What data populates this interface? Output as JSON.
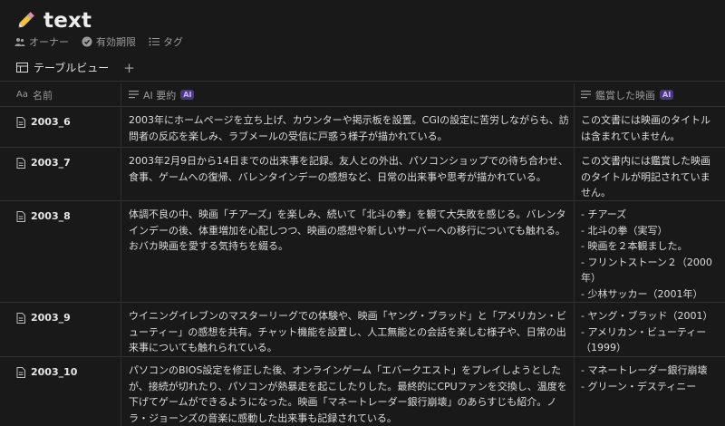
{
  "page": {
    "title": "text",
    "properties": [
      {
        "icon": "people-icon",
        "label": "オーナー"
      },
      {
        "icon": "check-badge-icon",
        "label": "有効期限"
      },
      {
        "icon": "list-icon",
        "label": "タグ"
      }
    ]
  },
  "view": {
    "label": "テーブルビュー",
    "add": "+"
  },
  "table": {
    "columns": [
      {
        "icon": "Aa",
        "label": "名前"
      },
      {
        "label": "AI 要約",
        "badge": "AI"
      },
      {
        "label": "鑑賞した映画",
        "badge": "AI"
      }
    ],
    "rows": [
      {
        "name": "2003_6",
        "summary": "2003年にホームページを立ち上げ、カウンターや掲示板を設置。CGIの設定に苦労しながらも、訪問者の反応を楽しみ、ラブメールの受信に戸惑う様子が描かれている。",
        "movies": [
          "この文書には映画のタイトルは含まれていません。"
        ]
      },
      {
        "name": "2003_7",
        "summary": "2003年2月9日から14日までの出来事を記録。友人との外出、パソコンショップでの待ち合わせ、食事、ゲームへの復帰、バレンタインデーの感想など、日常の出来事や思考が描かれている。",
        "movies": [
          "この文書内には鑑賞した映画のタイトルが明記されていません。"
        ]
      },
      {
        "name": "2003_8",
        "summary": "体調不良の中、映画「チアーズ」を楽しみ、続いて「北斗の拳」を観て大失敗を感じる。バレンタインデーの後、体重増加を心配しつつ、映画の感想や新しいサーバーへの移行についても触れる。おバカ映画を愛する気持ちを綴る。",
        "movies": [
          "- チアーズ",
          "- 北斗の拳（実写）",
          "- 映画を２本観ました。",
          "- フリントストーン２（2000年）",
          "- 少林サッカー（2001年）"
        ]
      },
      {
        "name": "2003_9",
        "summary": "ウイニングイレブンのマスターリーグでの体験や、映画「ヤング・ブラッド」と「アメリカン・ビューティー」の感想を共有。チャット機能を設置し、人工無能との会話を楽しむ様子や、日常の出来事についても触れられている。",
        "movies": [
          "- ヤング・ブラッド（2001）",
          "- アメリカン・ビューティー（1999）"
        ]
      },
      {
        "name": "2003_10",
        "summary": "パソコンのBIOS設定を修正した後、オンラインゲーム「エバークエスト」をプレイしようとしたが、接続が切れたり、パソコンが熱暴走を起こしたりした。最終的にCPUファンを交換し、温度を下げてゲームができるようになった。映画「マネートレーダー銀行崩壊」のあらすじも紹介。ノラ・ジョーンズの音楽に感動した出来事も記録されている。",
        "movies": [
          "- マネートレーダー銀行崩壊",
          "- グリーン・デスティニー"
        ]
      }
    ]
  }
}
